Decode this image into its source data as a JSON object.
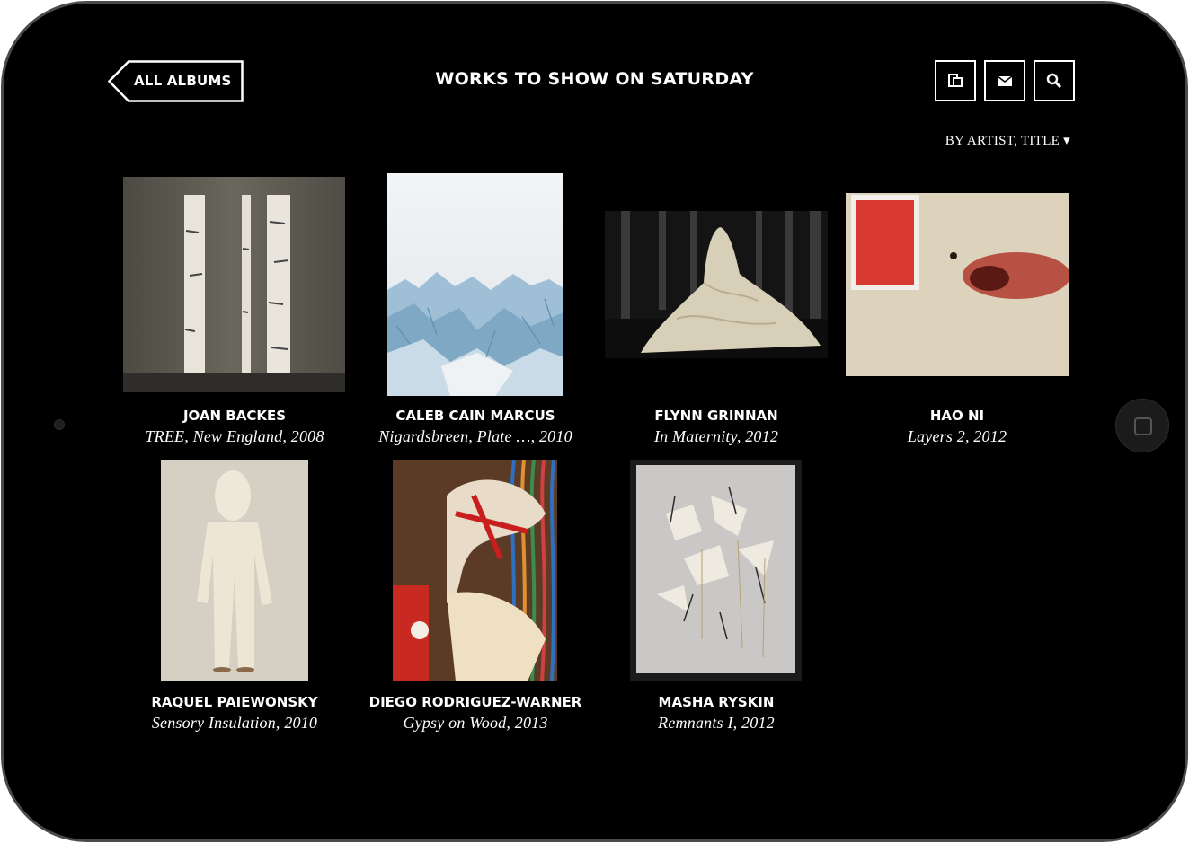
{
  "header": {
    "back_label": "ALL ALBUMS",
    "title": "WORKS TO SHOW ON SATURDAY",
    "tools": [
      "pages-icon",
      "mail-icon",
      "search-icon"
    ]
  },
  "sort": {
    "label": "BY ARTIST, TITLE ▾"
  },
  "works": [
    {
      "artist": "JOAN BACKES",
      "title": "TREE, New England, 2008"
    },
    {
      "artist": "CALEB CAIN MARCUS",
      "title": "Nigardsbreen, Plate …, 2010"
    },
    {
      "artist": "FLYNN GRINNAN",
      "title": "In Maternity, 2012"
    },
    {
      "artist": "HAO NI",
      "title": "Layers 2, 2012"
    },
    {
      "artist": "RAQUEL PAIEWONSKY",
      "title": "Sensory Insulation, 2010"
    },
    {
      "artist": "DIEGO RODRIGUEZ-WARNER",
      "title": "Gypsy on Wood, 2013"
    },
    {
      "artist": "MASHA RYSKIN",
      "title": "Remnants I, 2012"
    }
  ],
  "colors": {
    "background": "#000000",
    "text": "#ffffff",
    "bezel": "#4a4a4a"
  }
}
